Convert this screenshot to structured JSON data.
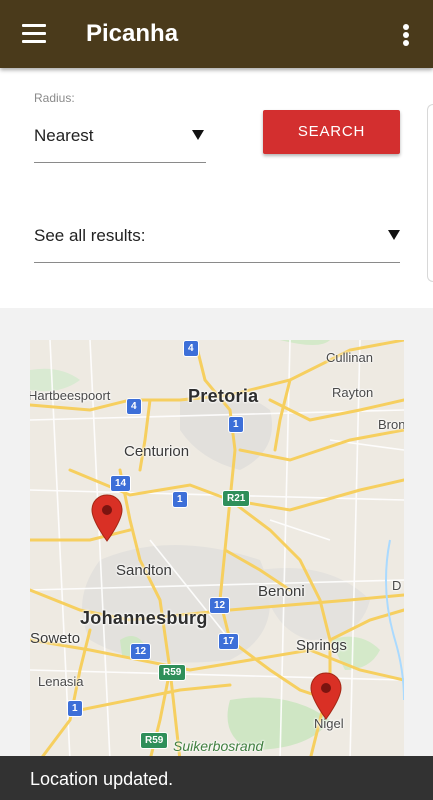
{
  "app": {
    "title": "Picanha"
  },
  "filters": {
    "radius_label": "Radius:",
    "radius_value": "Nearest",
    "search_label": "SEARCH",
    "results_label": "See all results:"
  },
  "map": {
    "places": {
      "cullinan": "Cullinan",
      "hartbeespoort": "Hartbeespoort",
      "pretoria": "Pretoria",
      "rayton": "Rayton",
      "bronkhorstspruit": "Bron",
      "centurion": "Centurion",
      "sandton": "Sandton",
      "benoni": "Benoni",
      "delmas": "D",
      "johannesburg": "Johannesburg",
      "soweto": "Soweto",
      "springs": "Springs",
      "lenasia": "Lenasia",
      "nigel": "Nigel",
      "suikerbosrand": "Suikerbosrand"
    },
    "shields": {
      "n4_top": "4",
      "n4_west": "4",
      "n1_pretoria": "1",
      "n14": "14",
      "n1_centurion": "1",
      "r21": "R21",
      "n12_east": "12",
      "n17": "17",
      "n12_west": "12",
      "r59_north": "R59",
      "n1_south": "1",
      "r59_south": "R59"
    },
    "pin_color": "#d93025"
  },
  "snackbar": {
    "message": "Location updated."
  },
  "colors": {
    "appbar": "#4a3a1b",
    "accent": "#d32f2f",
    "map_land": "#eeeae2",
    "major_road": "#f6cf5f",
    "motorway_shield": "#3d6fd8"
  }
}
